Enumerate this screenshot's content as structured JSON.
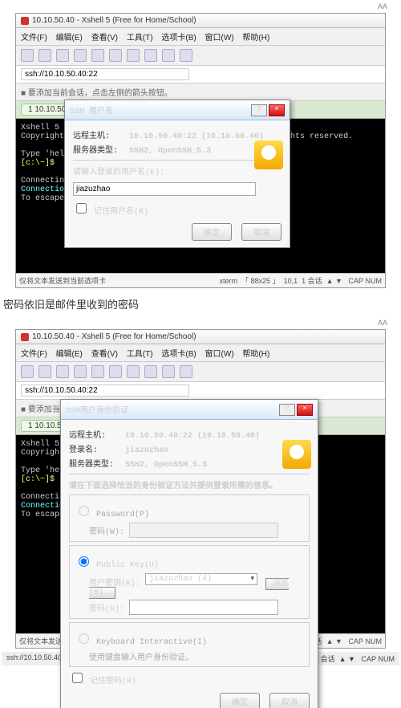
{
  "top_controls": {
    "a": "",
    "b": "",
    "c": "AA"
  },
  "caption2": "密码依旧是邮件里收到的密码",
  "app_title": "10.10.50.40 - Xshell 5 (Free for Home/School)",
  "menu": {
    "file": "文件(F)",
    "edit": "编辑(E)",
    "view": "查看(V)",
    "tools": "工具(T)",
    "tabs": "选项卡(B)",
    "window": "窗口(W)",
    "help": "帮助(H)"
  },
  "addr_value": "ssh://10.10.50.40:22",
  "hint_line": "■ 要添加当前会话，点击左侧的箭头按钮。",
  "tab_label": "1 10.10.50.40",
  "term1": {
    "l1": "Xshell 5 (Build 0964)",
    "l2": "Copyright (c) 2002-2016 NetSarang Computer, Inc. All rights reserved.",
    "l3a": "Type 'help' to learn",
    "prompt": "[c:\\~]$",
    "l4": "Connecting to 10.10.",
    "l5": "Connection establish",
    "l6": "To escape to local s"
  },
  "term2": {
    "l1": "Xshell 5 (Bui",
    "l2": "Copyright (c)",
    "l3a": "Type 'help' t",
    "prompt": "[c:\\~]$",
    "l4": "Connecting to",
    "l5": "Connection es",
    "l6": "To escape to"
  },
  "dlg1": {
    "title": "SSH 用户名",
    "host_lbl": "远程主机:",
    "host_val": "10.10.50.40:22 (10.10.50.40)",
    "srv_lbl": "服务器类型:",
    "srv_val": "SSH2, OpenSSH_5.3",
    "prompt": "请输入登录的用户名(E):",
    "user": "jiazuzhao",
    "remember": "记住用户名(R)",
    "ok": "确定",
    "cancel": "取消"
  },
  "dlg2": {
    "title": "SSH用户身份验证",
    "host_lbl": "远程主机:",
    "host_val": "10.10.50.40:22 (10.10.50.40)",
    "login_lbl": "登录名:",
    "login_val": "jiazuzhao",
    "srv_lbl": "服务器类型:",
    "srv_val": "SSH2, OpenSSH_5.3",
    "instruct": "请在下面选择恰当的身份验证方法并提供登录所需的信息。",
    "rb_pw": "Password(P)",
    "pw_lbl": "密码(W):",
    "rb_pk": "Public Key(U)",
    "key_lbl": "用户密钥(K):",
    "key_val": "jiazuzhao (4)",
    "browse": "浏览(B)…",
    "pass_lbl": "密码(H):",
    "rb_ki": "Keyboard Interactive(I)",
    "ki_hint": "使用键盘输入用户身份验证。",
    "remember_pw": "记住密码(R)",
    "ok": "确定",
    "cancel": "取消"
  },
  "status": {
    "left": "仅将文本发送到当前选项卡",
    "xterm": "xterm",
    "size": "88x25",
    "zoom": "10,1",
    "sess": "1 会话",
    "cap": "CAP",
    "num": "NUM"
  },
  "bottom_ssh": "ssh://10.10.50.40:22",
  "bottom_right_mark": ""
}
